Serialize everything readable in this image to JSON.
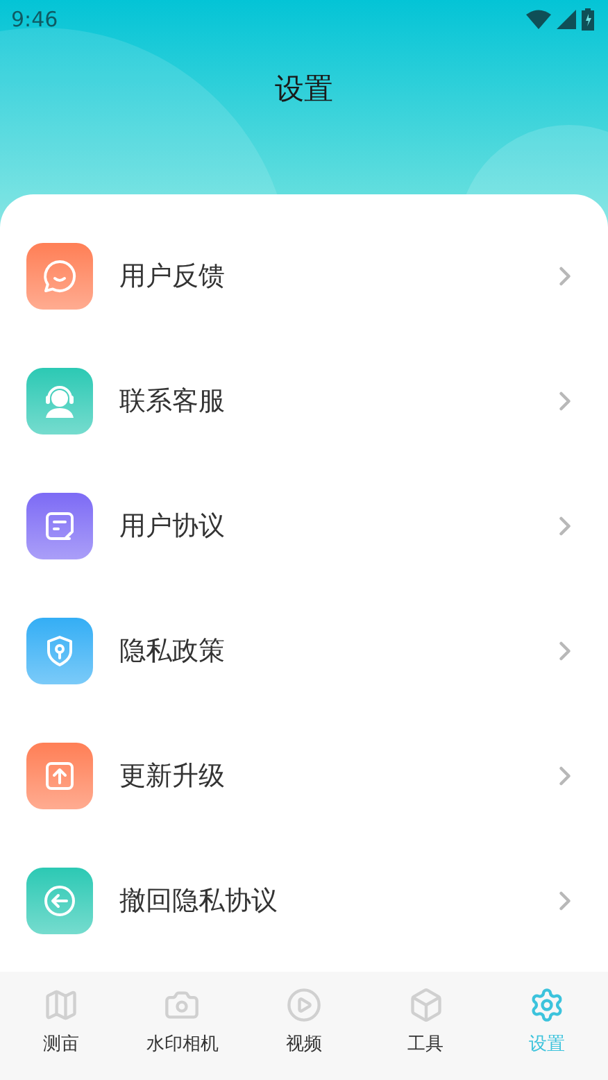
{
  "status_bar": {
    "time": "9:46"
  },
  "header": {
    "title": "设置"
  },
  "menu": [
    {
      "label": "用户反馈",
      "kind": "feedback",
      "color": "#ff7f56"
    },
    {
      "label": "联系客服",
      "kind": "support",
      "color": "#2cc9b4"
    },
    {
      "label": "用户协议",
      "kind": "agreement",
      "color": "#7d6bf5"
    },
    {
      "label": "隐私政策",
      "kind": "privacy",
      "color": "#34aef5"
    },
    {
      "label": "更新升级",
      "kind": "update",
      "color": "#ff7f56"
    },
    {
      "label": "撤回隐私协议",
      "kind": "revoke",
      "color": "#2cc9b4"
    }
  ],
  "tab_bar": [
    {
      "label": "测亩",
      "kind": "map",
      "selected": false
    },
    {
      "label": "水印相机",
      "kind": "camera",
      "selected": false
    },
    {
      "label": "视频",
      "kind": "video",
      "selected": false
    },
    {
      "label": "工具",
      "kind": "box",
      "selected": false
    },
    {
      "label": "设置",
      "kind": "settings",
      "selected": true
    }
  ]
}
